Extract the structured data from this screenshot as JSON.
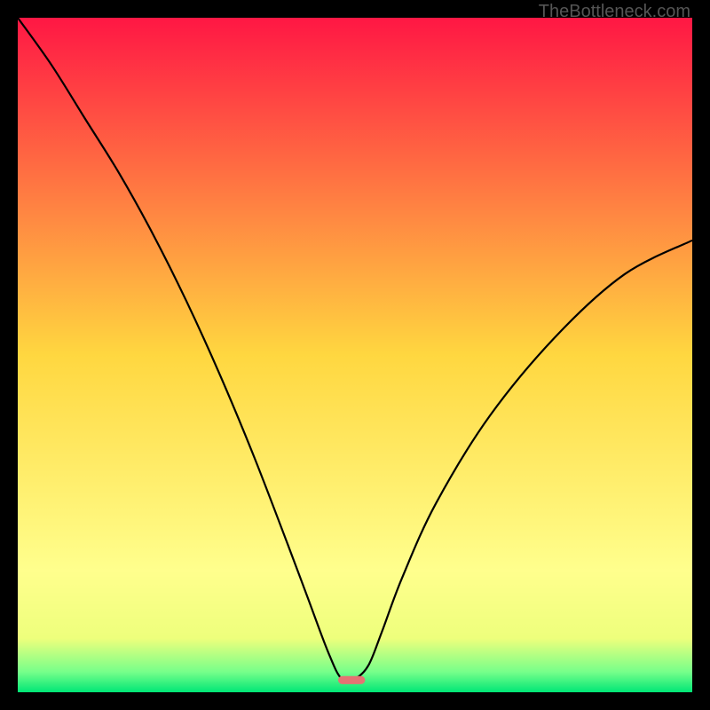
{
  "watermark": "TheBottleneck.com",
  "chart_data": {
    "type": "line",
    "title": "",
    "xlabel": "",
    "ylabel": "",
    "xlim": [
      0,
      100
    ],
    "ylim": [
      0,
      100
    ],
    "background_gradient": {
      "stops": [
        {
          "offset": 0,
          "color": "#ff1744"
        },
        {
          "offset": 50,
          "color": "#ffd740"
        },
        {
          "offset": 82,
          "color": "#ffff8d"
        },
        {
          "offset": 92,
          "color": "#eeff7c"
        },
        {
          "offset": 97,
          "color": "#76ff8a"
        },
        {
          "offset": 100,
          "color": "#00e676"
        }
      ]
    },
    "curve": {
      "x": [
        0,
        5,
        10,
        15,
        20,
        25,
        30,
        35,
        40,
        43,
        46,
        48,
        50,
        52,
        54,
        57,
        62,
        70,
        80,
        90,
        100
      ],
      "y": [
        100,
        93,
        85,
        77,
        68,
        58,
        47,
        35,
        22,
        14,
        6,
        2,
        2,
        4,
        9,
        17,
        28,
        41,
        53,
        62,
        67
      ]
    },
    "marker": {
      "x": 49.5,
      "y": 1.8,
      "width": 4,
      "height": 1.2,
      "color": "#e57373"
    }
  }
}
